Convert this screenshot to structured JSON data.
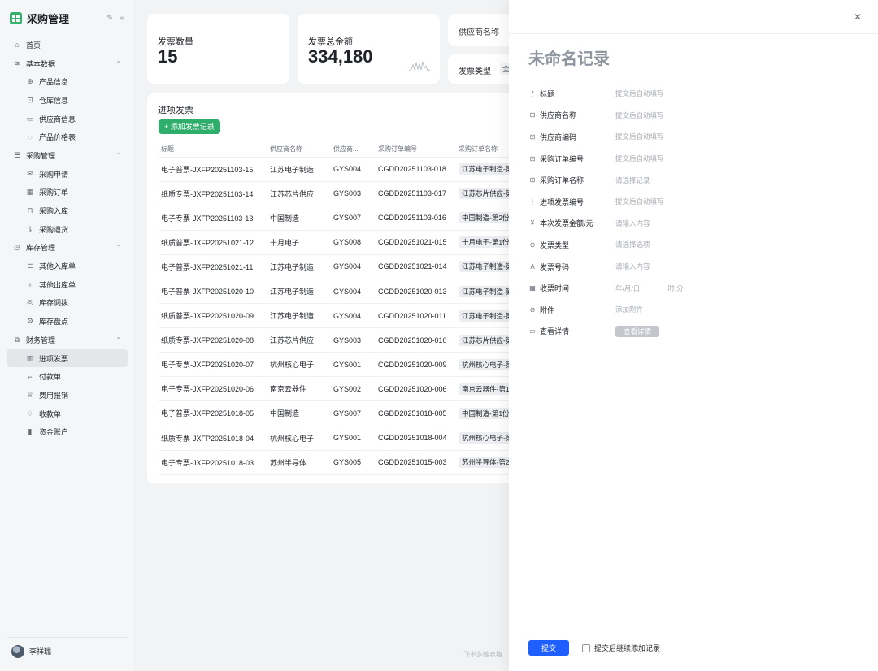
{
  "app": {
    "title": "采购管理"
  },
  "sidebar": {
    "items": [
      {
        "label": "首页",
        "icon": "home-icon",
        "glyph": "⌂",
        "kind": "top"
      },
      {
        "label": "基本数据",
        "icon": "layers-icon",
        "glyph": "≋",
        "kind": "group",
        "expanded": true
      },
      {
        "label": "产品信息",
        "icon": "globe-icon",
        "glyph": "⊕",
        "kind": "sub"
      },
      {
        "label": "仓库信息",
        "icon": "warehouse-icon",
        "glyph": "⊡",
        "kind": "sub"
      },
      {
        "label": "供应商信息",
        "icon": "monitor-icon",
        "glyph": "▭",
        "kind": "sub"
      },
      {
        "label": "产品价格表",
        "icon": "price-icon",
        "glyph": "◌",
        "kind": "sub"
      },
      {
        "label": "采购管理",
        "icon": "stack-icon",
        "glyph": "☰",
        "kind": "group",
        "expanded": true
      },
      {
        "label": "采购申请",
        "icon": "mail-icon",
        "glyph": "✉",
        "kind": "sub"
      },
      {
        "label": "采购订单",
        "icon": "calendar-icon",
        "glyph": "▦",
        "kind": "sub"
      },
      {
        "label": "采购入库",
        "icon": "inbox-icon",
        "glyph": "⊓",
        "kind": "sub"
      },
      {
        "label": "采购退货",
        "icon": "return-icon",
        "glyph": "⇂",
        "kind": "sub"
      },
      {
        "label": "库存管理",
        "icon": "clock-icon",
        "glyph": "◷",
        "kind": "group",
        "expanded": true
      },
      {
        "label": "其他入库单",
        "icon": "import-icon",
        "glyph": "⊏",
        "kind": "sub"
      },
      {
        "label": "其他出库单",
        "icon": "export-icon",
        "glyph": "♁",
        "kind": "sub"
      },
      {
        "label": "库存调拨",
        "icon": "transfer-icon",
        "glyph": "◎",
        "kind": "sub"
      },
      {
        "label": "库存盘点",
        "icon": "inventory-icon",
        "glyph": "⚙",
        "kind": "sub"
      },
      {
        "label": "财务管理",
        "icon": "copy-icon",
        "glyph": "⧉",
        "kind": "group",
        "expanded": true
      },
      {
        "label": "进项发票",
        "icon": "barcode-icon",
        "glyph": "▥",
        "kind": "sub",
        "active": true
      },
      {
        "label": "付款单",
        "icon": "chart-line-icon",
        "glyph": "⌐",
        "kind": "sub"
      },
      {
        "label": "费用报销",
        "icon": "trophy-icon",
        "glyph": "♕",
        "kind": "sub"
      },
      {
        "label": "收款单",
        "icon": "bulb-icon",
        "glyph": "♢",
        "kind": "sub"
      },
      {
        "label": "资金账户",
        "icon": "bar-chart-icon",
        "glyph": "▮",
        "kind": "sub"
      }
    ],
    "user_name": "李祥瑞"
  },
  "stats": {
    "invoice_count_label": "发票数量",
    "invoice_count_value": "15",
    "invoice_total_label": "发票总金额",
    "invoice_total_value": "334,180"
  },
  "filters": {
    "supplier_label": "供应商名称",
    "invoice_type_label": "发票类型",
    "invoice_type_value": "全"
  },
  "invoices": {
    "section_title": "进项发票",
    "add_button": "+ 添加发票记录",
    "columns": [
      "标题",
      "供应商名称",
      "供应商...",
      "采购订单编号",
      "采购订单名称"
    ],
    "rows": [
      [
        "电子普票-JXFP20251103-15",
        "江苏电子制造",
        "GYS004",
        "CGDD20251103-018",
        "江苏电子制造-第"
      ],
      [
        "纸质专票-JXFP20251103-14",
        "江苏芯片供应",
        "GYS003",
        "CGDD20251103-017",
        "江苏芯片供应-第"
      ],
      [
        "电子专票-JXFP20251103-13",
        "中国制造",
        "GYS007",
        "CGDD20251103-016",
        "中国制造-第2份"
      ],
      [
        "纸质普票-JXFP20251021-12",
        "十月电子",
        "GYS008",
        "CGDD20251021-015",
        "十月电子-第1份"
      ],
      [
        "电子普票-JXFP20251021-11",
        "江苏电子制造",
        "GYS004",
        "CGDD20251021-014",
        "江苏电子制造-第"
      ],
      [
        "电子普票-JXFP20251020-10",
        "江苏电子制造",
        "GYS004",
        "CGDD20251020-013",
        "江苏电子制造-第"
      ],
      [
        "纸质普票-JXFP20251020-09",
        "江苏电子制造",
        "GYS004",
        "CGDD20251020-011",
        "江苏电子制造-第"
      ],
      [
        "纸质专票-JXFP20251020-08",
        "江苏芯片供应",
        "GYS003",
        "CGDD20251020-010",
        "江苏芯片供应-第"
      ],
      [
        "电子专票-JXFP20251020-07",
        "杭州核心电子",
        "GYS001",
        "CGDD20251020-009",
        "杭州核心电子-第"
      ],
      [
        "电子专票-JXFP20251020-06",
        "南京云器件",
        "GYS002",
        "CGDD20251020-006",
        "南京云器件-第1"
      ],
      [
        "电子普票-JXFP20251018-05",
        "中国制造",
        "GYS007",
        "CGDD20251018-005",
        "中国制造-第1份"
      ],
      [
        "纸质专票-JXFP20251018-04",
        "杭州核心电子",
        "GYS001",
        "CGDD20251018-004",
        "杭州核心电子-第"
      ],
      [
        "电子专票-JXFP20251018-03",
        "苏州半导体",
        "GYS005",
        "CGDD20251015-003",
        "苏州半导体-第2"
      ]
    ]
  },
  "footer_note": "飞书多维表格",
  "drawer": {
    "title": "未命名记录",
    "fields": [
      {
        "label": "标题",
        "icon": "formula-icon",
        "glyph": "ƒ",
        "value": "提交后自动填写"
      },
      {
        "label": "供应商名称",
        "icon": "lookup-icon",
        "glyph": "⊡",
        "value": "提交后自动填写"
      },
      {
        "label": "供应商编码",
        "icon": "lookup-icon",
        "glyph": "⊡",
        "value": "提交后自动填写"
      },
      {
        "label": "采购订单编号",
        "icon": "lookup-icon",
        "glyph": "⊡",
        "value": "提交后自动填写"
      },
      {
        "label": "采购订单名称",
        "icon": "link-record-icon",
        "glyph": "⊞",
        "value": "请选择记录"
      },
      {
        "label": "进项发票编号",
        "icon": "auto-number-icon",
        "glyph": "⋮",
        "value": "提交后自动填写"
      },
      {
        "label": "本次发票金额/元",
        "icon": "currency-icon",
        "glyph": "¥",
        "value": "请输入内容"
      },
      {
        "label": "发票类型",
        "icon": "single-select-icon",
        "glyph": "⊙",
        "value": "请选择选项"
      },
      {
        "label": "发票号码",
        "icon": "text-icon",
        "glyph": "A",
        "value": "请输入内容"
      },
      {
        "label": "收票时间",
        "icon": "date-icon",
        "glyph": "▦",
        "value": "年/月/日",
        "value2": "时:分"
      },
      {
        "label": "附件",
        "icon": "attachment-icon",
        "glyph": "⊘",
        "value": "添加附件"
      },
      {
        "label": "查看详情",
        "icon": "button-field-icon",
        "glyph": "▭",
        "button": "查看详情"
      }
    ],
    "submit_label": "提交",
    "continue_label": "提交后继续添加记录"
  }
}
